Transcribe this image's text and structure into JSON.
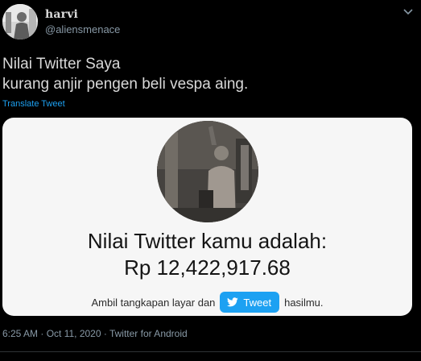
{
  "author": {
    "display_name": "harvi",
    "handle": "@aliensmenace"
  },
  "tweet": {
    "line1": "Nilai Twitter Saya",
    "line2": "kurang anjir pengen beli vespa aing.",
    "translate_label": "Translate Tweet"
  },
  "card": {
    "headline": "Nilai Twitter kamu adalah:",
    "value": "Rp 12,422,917.68",
    "cta_before": "Ambil tangkapan layar dan",
    "tweet_button_label": "Tweet",
    "cta_after": "hasilmu."
  },
  "meta": {
    "timestamp": "6:25 AM · Oct 11, 2020 · Twitter for Android"
  },
  "colors": {
    "background": "#000000",
    "link": "#1da1f2",
    "muted": "#8899a6",
    "card_bg": "#f6f6f6"
  },
  "icons": {
    "more": "chevron-down-icon",
    "bird": "twitter-bird-icon"
  }
}
